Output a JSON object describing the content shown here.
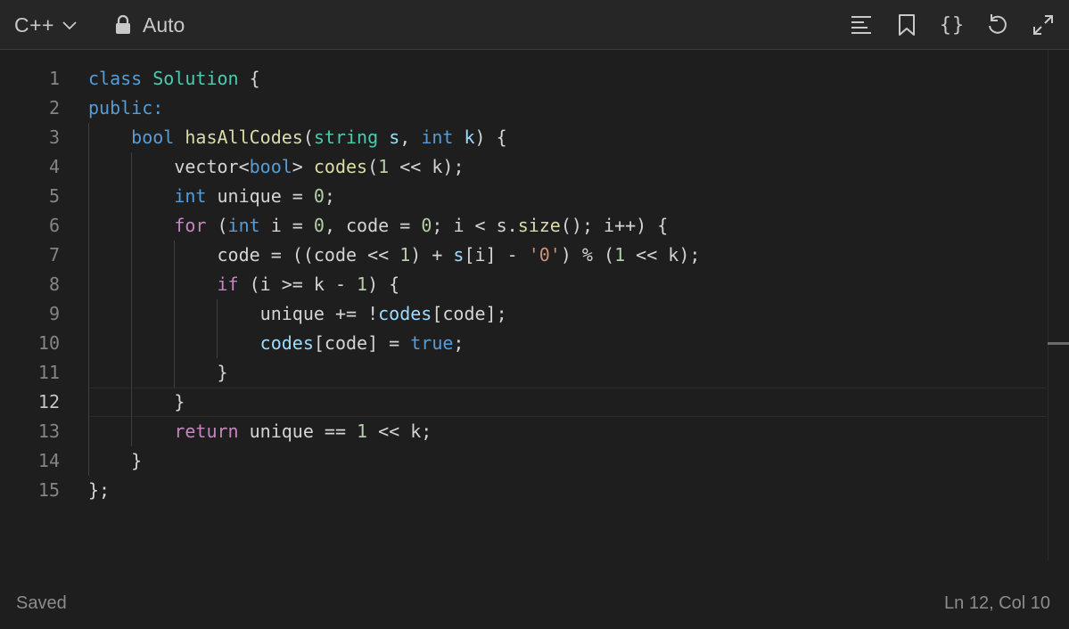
{
  "toolbar": {
    "language": "C++",
    "mode": "Auto",
    "icons": [
      "format-icon",
      "bookmark-icon",
      "braces-icon",
      "reset-icon",
      "expand-icon"
    ],
    "braces_glyph": "{}"
  },
  "editor": {
    "current_line": 12,
    "lines": [
      {
        "n": "1",
        "tokens": [
          [
            "kw",
            "class"
          ],
          [
            "",
            " "
          ],
          [
            "ty",
            "Solution"
          ],
          [
            "",
            " {"
          ]
        ]
      },
      {
        "n": "2",
        "tokens": [
          [
            "kw",
            "public:"
          ]
        ]
      },
      {
        "n": "3",
        "tokens": [
          [
            "",
            "    "
          ],
          [
            "kw",
            "bool"
          ],
          [
            "",
            " "
          ],
          [
            "fn",
            "hasAllCodes"
          ],
          [
            "",
            "("
          ],
          [
            "ty",
            "string"
          ],
          [
            "",
            " "
          ],
          [
            "pm",
            "s"
          ],
          [
            "",
            ", "
          ],
          [
            "kw",
            "int"
          ],
          [
            "",
            " "
          ],
          [
            "pm",
            "k"
          ],
          [
            "",
            ") {"
          ]
        ]
      },
      {
        "n": "4",
        "tokens": [
          [
            "",
            "        "
          ],
          [
            "",
            "vector<"
          ],
          [
            "kw",
            "bool"
          ],
          [
            "",
            "> "
          ],
          [
            "fn",
            "codes"
          ],
          [
            "",
            "("
          ],
          [
            "nu",
            "1"
          ],
          [
            "",
            " << k);"
          ]
        ]
      },
      {
        "n": "5",
        "tokens": [
          [
            "",
            "        "
          ],
          [
            "kw",
            "int"
          ],
          [
            "",
            " unique = "
          ],
          [
            "nu",
            "0"
          ],
          [
            "",
            ";"
          ]
        ]
      },
      {
        "n": "6",
        "tokens": [
          [
            "",
            "        "
          ],
          [
            "ct",
            "for"
          ],
          [
            "",
            " ("
          ],
          [
            "kw",
            "int"
          ],
          [
            "",
            " i = "
          ],
          [
            "nu",
            "0"
          ],
          [
            "",
            ", code = "
          ],
          [
            "nu",
            "0"
          ],
          [
            "",
            "; i < s."
          ],
          [
            "fn",
            "size"
          ],
          [
            "",
            "(); i++) {"
          ]
        ]
      },
      {
        "n": "7",
        "tokens": [
          [
            "",
            "            "
          ],
          [
            "",
            "code = ((code << "
          ],
          [
            "nu",
            "1"
          ],
          [
            "",
            ") + "
          ],
          [
            "pm",
            "s"
          ],
          [
            "",
            "[i] - "
          ],
          [
            "st",
            "'0'"
          ],
          [
            "",
            ") % ("
          ],
          [
            "nu",
            "1"
          ],
          [
            "",
            " << k);"
          ]
        ]
      },
      {
        "n": "8",
        "tokens": [
          [
            "",
            "            "
          ],
          [
            "ct",
            "if"
          ],
          [
            "",
            " (i >= k - "
          ],
          [
            "nu",
            "1"
          ],
          [
            "",
            ") {"
          ]
        ]
      },
      {
        "n": "9",
        "tokens": [
          [
            "",
            "                "
          ],
          [
            "",
            "unique += !"
          ],
          [
            "pm",
            "codes"
          ],
          [
            "",
            "[code];"
          ]
        ]
      },
      {
        "n": "10",
        "tokens": [
          [
            "",
            "                "
          ],
          [
            "pm",
            "codes"
          ],
          [
            "",
            "[code] = "
          ],
          [
            "kw",
            "true"
          ],
          [
            "",
            ";"
          ]
        ]
      },
      {
        "n": "11",
        "tokens": [
          [
            "",
            "            "
          ],
          [
            "",
            "}"
          ]
        ]
      },
      {
        "n": "12",
        "tokens": [
          [
            "",
            "        "
          ],
          [
            "",
            "}"
          ]
        ]
      },
      {
        "n": "13",
        "tokens": [
          [
            "",
            "        "
          ],
          [
            "ct",
            "return"
          ],
          [
            "",
            " unique == "
          ],
          [
            "nu",
            "1"
          ],
          [
            "",
            " << k;"
          ]
        ]
      },
      {
        "n": "14",
        "tokens": [
          [
            "",
            "    "
          ],
          [
            "",
            "}"
          ]
        ]
      },
      {
        "n": "15",
        "tokens": [
          [
            "",
            "};"
          ]
        ]
      }
    ]
  },
  "status": {
    "saved": "Saved",
    "position": "Ln 12, Col 10"
  }
}
